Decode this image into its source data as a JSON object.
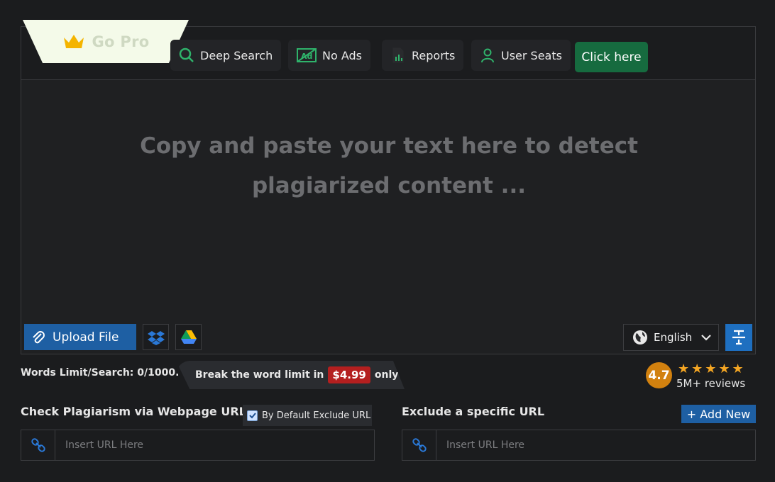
{
  "topbar": {
    "gopro_label": "Go Pro",
    "features": [
      {
        "label": "Deep Search",
        "icon": "search-icon"
      },
      {
        "label": "No Ads",
        "icon": "no-ads-icon"
      },
      {
        "label": "Reports",
        "icon": "report-icon"
      },
      {
        "label": "User Seats",
        "icon": "user-icon"
      }
    ],
    "cta_label": "Click here"
  },
  "editor": {
    "placeholder": "Copy and paste your text here to detect plagiarized content ..."
  },
  "toolbar": {
    "upload_label": "Upload File",
    "language": "English"
  },
  "limits": {
    "words_limit": "Words Limit/Search: 0/1000.",
    "break_text": "Break the word limit in",
    "price": "$4.99",
    "only": "only"
  },
  "rating": {
    "score": "4.7",
    "stars": "★★★★★",
    "reviews": "5M+ reviews"
  },
  "url_check": {
    "title": "Check Plagiarism via Webpage URL",
    "exclude_default_label": "By Default Exclude URL",
    "placeholder": "Insert URL Here"
  },
  "url_exclude": {
    "title": "Exclude a specific URL",
    "add_label": "+ Add New",
    "placeholder": "Insert URL Here"
  },
  "colors": {
    "accent_blue": "#1e5fa3",
    "cta_green": "#166b3f",
    "price_red": "#b41f1f",
    "rating_orange": "#d2810f"
  }
}
